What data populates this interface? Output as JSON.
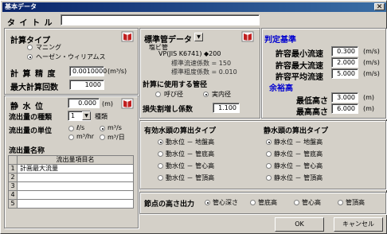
{
  "window": {
    "title": "基本データ",
    "close_glyph": "✕"
  },
  "title_field": {
    "label": "タ イ ト ル",
    "value": ""
  },
  "calc": {
    "type_label": "計算タイプ",
    "options": [
      "マニング",
      "ヘーゼン・ウィリアムス"
    ],
    "accuracy_label": "計 算 精 度",
    "accuracy_value": "0.0010000",
    "accuracy_unit": "(m³/s)",
    "max_iter_label": "最大計算回数",
    "max_iter_value": "1000"
  },
  "pipe": {
    "header": "標準管データ",
    "pipe_name": "塩ビ管",
    "pipe_spec": "VP(JIS K6741) ◆200",
    "coef_label": "標準流速係数 = 150",
    "rough_label": "標準粗度係数 = 0.010",
    "diameter_label": "計算に使用する管径",
    "diameter_options": [
      "呼び径",
      "実内径"
    ],
    "loss_label": "損失割増し係数",
    "loss_value": "1.100"
  },
  "judge": {
    "header": "判定基準",
    "rows": [
      {
        "label": "許容最小流速",
        "value": "0.300",
        "unit": "(m/s)"
      },
      {
        "label": "許容最大流速",
        "value": "2.000",
        "unit": "(m/s)"
      },
      {
        "label": "許容平均流速",
        "value": "5.000",
        "unit": "(m/s)"
      }
    ],
    "margin_header": "余裕高",
    "margin_rows": [
      {
        "label": "最低高さ",
        "value": "3.000",
        "unit": "(m)"
      },
      {
        "label": "最高高さ",
        "value": "6.000",
        "unit": "(m)"
      }
    ]
  },
  "water": {
    "static_label": "静 水 位",
    "static_value": "0.000",
    "static_unit": "(m)",
    "count_label": "流出量の種類",
    "count_value": "1",
    "count_suffix": "種類",
    "unit_label": "流出量の単位",
    "unit_options": [
      "ℓ/s",
      "m³/s",
      "m³/hr",
      "m³/日"
    ],
    "names_label": "流出量名称",
    "table_header": "流出量項目名",
    "rows": [
      {
        "no": "1",
        "name": "計画最大流量"
      },
      {
        "no": "2",
        "name": ""
      },
      {
        "no": "3",
        "name": ""
      },
      {
        "no": "4",
        "name": ""
      },
      {
        "no": "5",
        "name": ""
      }
    ]
  },
  "effective": {
    "header": "有効水頭の算出タイプ",
    "options": [
      "動水位 － 地盤高",
      "動水位 － 管底高",
      "動水位 － 管心高",
      "動水位 － 管頂高"
    ]
  },
  "statichead": {
    "header": "静水頭の算出タイプ",
    "options": [
      "静水位 － 地盤高",
      "静水位 － 管底高",
      "静水位 － 管心高",
      "静水位 － 管頂高"
    ]
  },
  "node": {
    "label": "節点の高さ出力",
    "options": [
      "管心深さ",
      "管底高",
      "管心高",
      "管頂高"
    ]
  },
  "buttons": {
    "ok": "OK",
    "cancel": "キャンセル"
  }
}
